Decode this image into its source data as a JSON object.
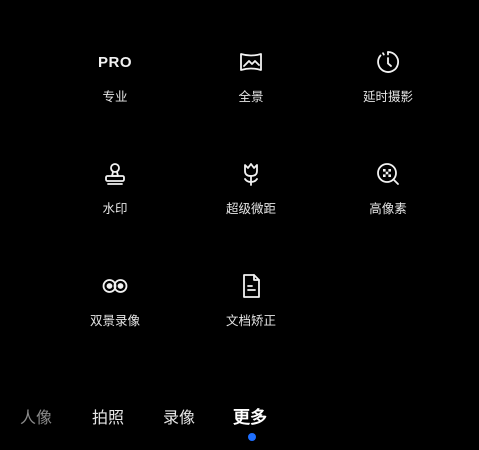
{
  "modes": [
    {
      "label": "专业",
      "icon": "pro-text-icon",
      "icon_text": "PRO"
    },
    {
      "label": "全景",
      "icon": "panorama-icon"
    },
    {
      "label": "延时摄影",
      "icon": "timelapse-icon"
    },
    {
      "label": "水印",
      "icon": "stamp-icon"
    },
    {
      "label": "超级微距",
      "icon": "tulip-macro-icon"
    },
    {
      "label": "高像素",
      "icon": "hi-res-magnifier-icon"
    },
    {
      "label": "双景录像",
      "icon": "dual-view-icon"
    },
    {
      "label": "文档矫正",
      "icon": "document-icon"
    }
  ],
  "tabs": [
    {
      "label": "人像"
    },
    {
      "label": "拍照"
    },
    {
      "label": "录像"
    },
    {
      "label": "更多"
    }
  ],
  "active_tab": "更多",
  "colors": {
    "background": "#000000",
    "text": "#f2f2f2",
    "indicator": "#1f6fff"
  }
}
